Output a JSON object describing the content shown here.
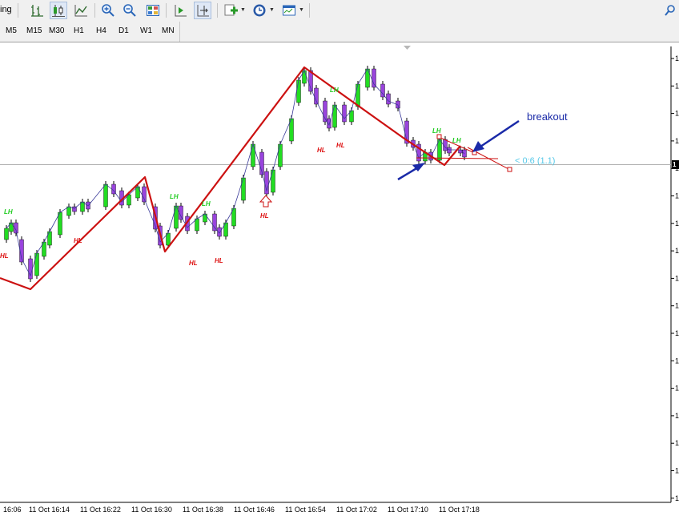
{
  "toolbar": {
    "partial_label": "ing",
    "buttons": [
      {
        "name": "bar-chart-icon"
      },
      {
        "name": "candlestick-chart-icon"
      },
      {
        "name": "line-chart-icon"
      },
      {
        "name": "zoom-in-icon"
      },
      {
        "name": "zoom-out-icon"
      },
      {
        "name": "tile-windows-icon"
      },
      {
        "name": "auto-scroll-icon"
      },
      {
        "name": "chart-shift-icon"
      },
      {
        "name": "indicators-icon"
      },
      {
        "name": "periods-clock-icon"
      },
      {
        "name": "templates-icon"
      },
      {
        "name": "search-icon"
      }
    ]
  },
  "timeframes": [
    "M5",
    "M15",
    "M30",
    "H1",
    "H4",
    "D1",
    "W1",
    "MN"
  ],
  "chart": {
    "breakout_label": "breakout",
    "projection_label": "< 0:6 (1.1)",
    "lh_label": "LH",
    "hl_label": "HL",
    "price_label_partial": "1",
    "x_labels": [
      "16:06",
      "11 Oct 16:14",
      "11 Oct 16:22",
      "11 Oct 16:30",
      "11 Oct 16:38",
      "11 Oct 16:46",
      "11 Oct 16:54",
      "11 Oct 17:02",
      "11 Oct 17:10",
      "11 Oct 17:18"
    ],
    "colors": {
      "bull": "#22dd22",
      "bear": "#9944dd",
      "zigzag": "#cc1111",
      "arrow": "#1a2aa8",
      "projection": "#55c8e8"
    }
  }
}
